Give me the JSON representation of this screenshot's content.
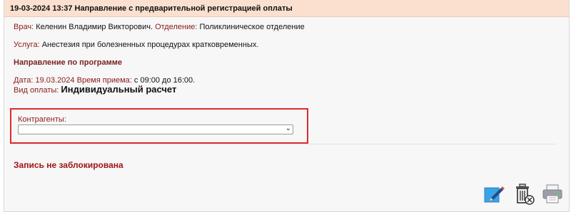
{
  "header": {
    "title": "19-03-2024 13:37 Направление с предварительной регистрацией оплаты"
  },
  "doctor": {
    "label": "Врач:",
    "value": "Келенин Владимир Викторович.",
    "department_label": "Отделение:",
    "department_value": "Поликлиническое отделение"
  },
  "service": {
    "label": "Услуга:",
    "value": "Анестезия при болезненных процедурах кратковременных."
  },
  "program": {
    "title": "Направление по программе"
  },
  "schedule": {
    "date_label": "Дата:",
    "date_value": "19.03.2024",
    "time_label": "Время приема:",
    "time_value": "с 09:00 до 16:00."
  },
  "payment": {
    "label": "Вид оплаты:",
    "value": "Индивидуальный расчет"
  },
  "contractors": {
    "label": "Контрагенты:",
    "selected": ""
  },
  "status": {
    "lock_text": "Запись не заблокирована"
  },
  "actions": {
    "edit_icon": "edit-icon",
    "delete_icon": "delete-icon",
    "print_icon": "print-icon"
  },
  "colors": {
    "header_bg": "#fbe0d0",
    "label": "#8b1a1a",
    "highlight_border": "#e02a2a",
    "status_text": "#a11414"
  }
}
